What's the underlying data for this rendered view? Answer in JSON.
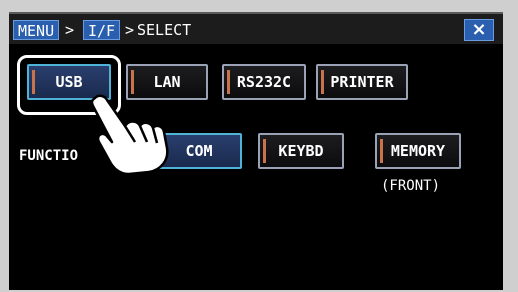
{
  "header": {
    "menu_label": "MENU",
    "sep1": ">",
    "if_label": "I/F",
    "sep2": ">",
    "title": "SELECT",
    "close_label": "×"
  },
  "interfaces": [
    {
      "label": "USB",
      "selected": true
    },
    {
      "label": "LAN",
      "selected": false
    },
    {
      "label": "RS232C",
      "selected": false
    },
    {
      "label": "PRINTER",
      "selected": false
    }
  ],
  "function": {
    "label": "FUNCTIO",
    "options": [
      {
        "label": "COM",
        "selected": true
      },
      {
        "label": "KEYBD",
        "selected": false
      },
      {
        "label": "MEMORY",
        "selected": false
      }
    ],
    "memory_note": "(FRONT)"
  },
  "icons": {
    "pointer": "pointing-hand-icon"
  },
  "colors": {
    "accent": "#2a5fb0",
    "selected_border": "#4fb3d8",
    "background": "#000000"
  }
}
